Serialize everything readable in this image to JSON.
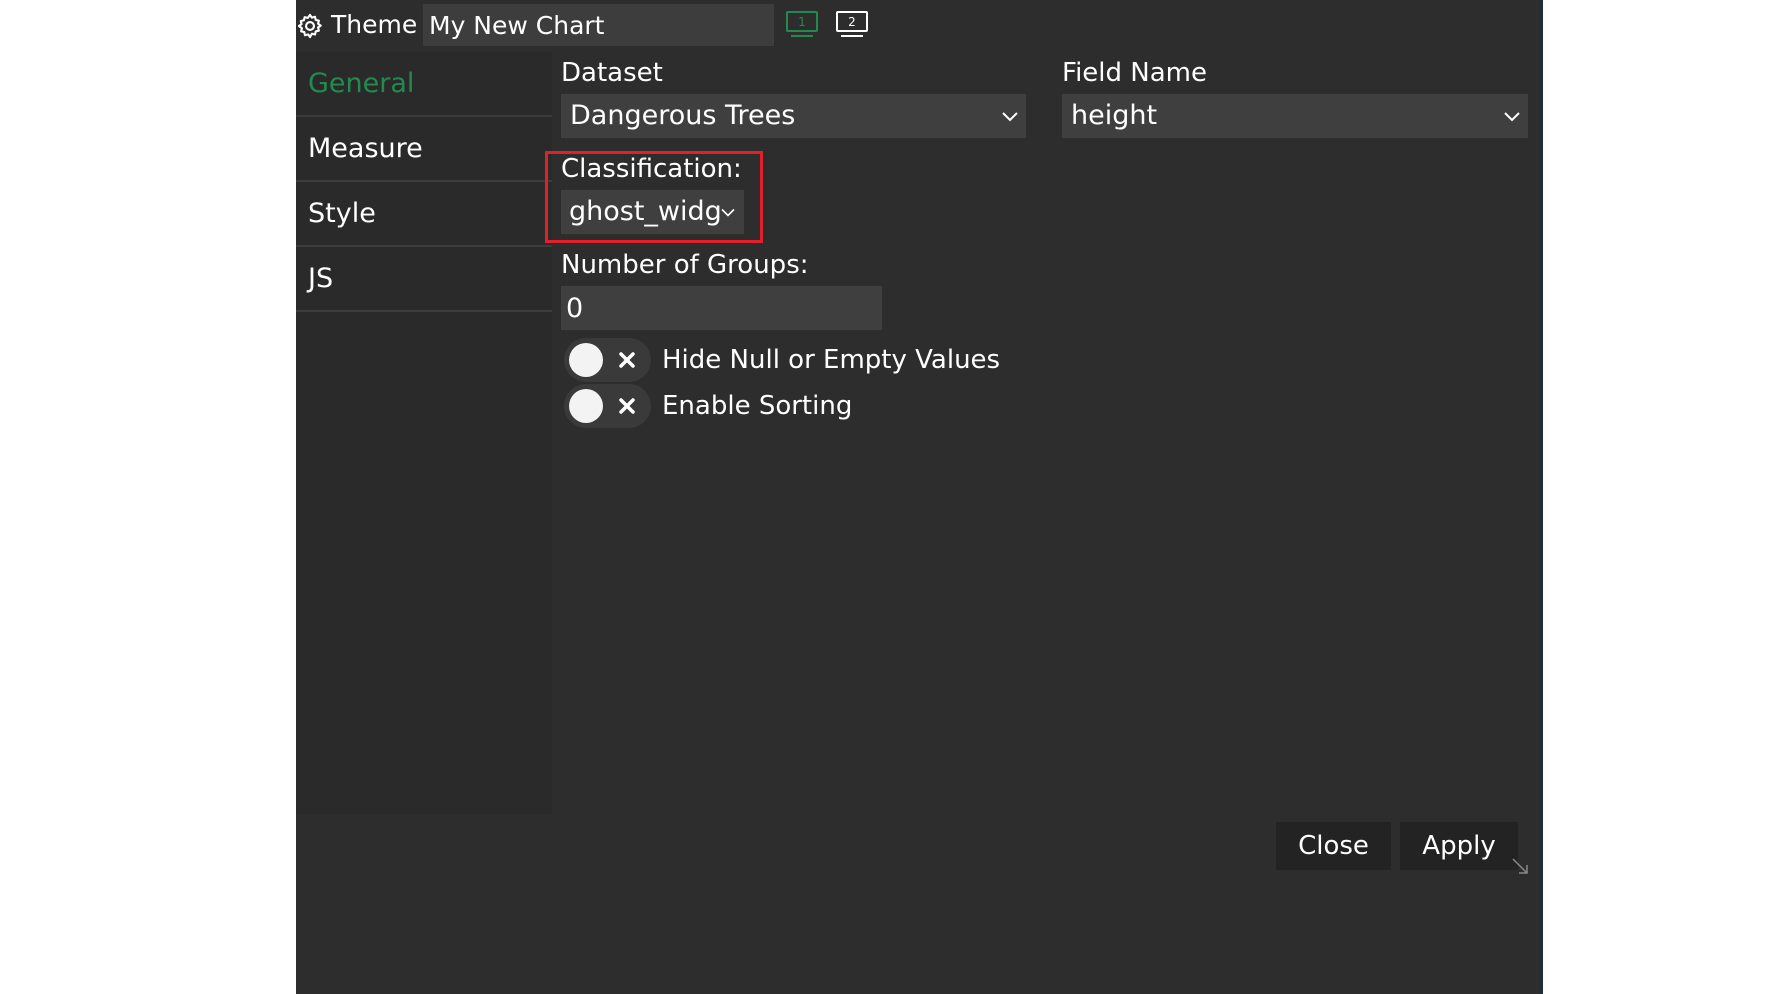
{
  "header": {
    "theme_label": "Theme",
    "chart_title": "My New Chart",
    "monitor_1": "1",
    "monitor_2": "2"
  },
  "sidebar": {
    "items": [
      {
        "label": "General",
        "active": true
      },
      {
        "label": "Measure",
        "active": false
      },
      {
        "label": "Style",
        "active": false
      },
      {
        "label": "JS",
        "active": false
      }
    ]
  },
  "general": {
    "dataset_label": "Dataset",
    "dataset_value": "Dangerous Trees",
    "field_name_label": "Field Name",
    "field_name_value": "height",
    "classification_label": "Classification:",
    "classification_value": "ghost_widg",
    "groups_label": "Number of Groups:",
    "groups_value": "0",
    "hide_null_label": "Hide Null or Empty Values",
    "hide_null_enabled": false,
    "sorting_label": "Enable Sorting",
    "sorting_enabled": false
  },
  "footer": {
    "close_label": "Close",
    "apply_label": "Apply"
  },
  "colors": {
    "background": "#2d2d2d",
    "sidebar": "#2a2a2a",
    "field": "#3f3f3f",
    "accent_green": "#23894f",
    "highlight_red": "#e0202b",
    "text": "#ffffff"
  },
  "icons": {
    "settings": "gear-icon",
    "monitor": "monitor-icon",
    "dropdown": "chevron-down-icon",
    "toggle_off": "x-icon",
    "resize": "resize-handle-icon"
  }
}
